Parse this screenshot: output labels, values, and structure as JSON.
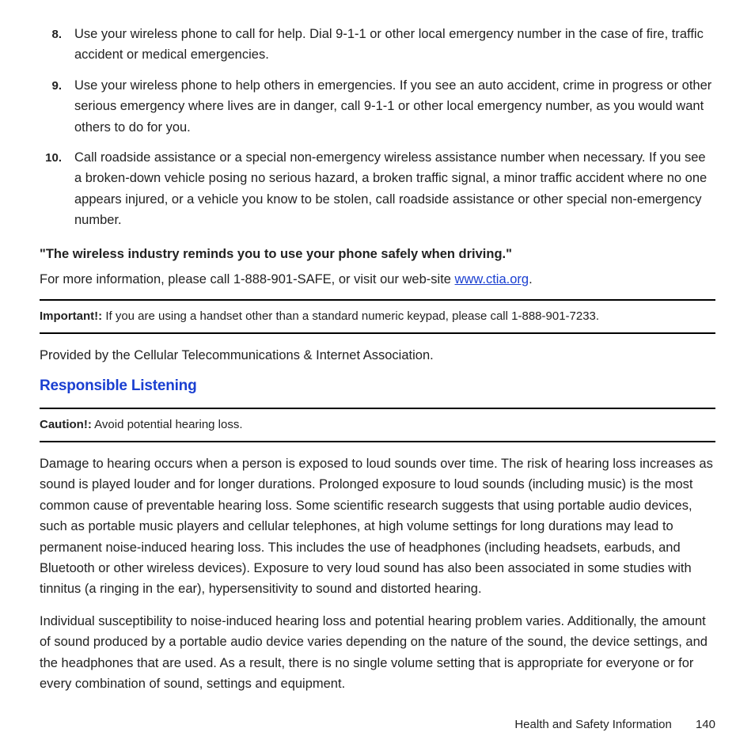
{
  "list": [
    {
      "num": "8.",
      "text": "Use your wireless phone to call for help. Dial 9-1-1 or other local emergency number in the case of fire, traffic accident or medical emergencies."
    },
    {
      "num": "9.",
      "text": "Use your wireless phone to help others in emergencies. If you see an auto accident, crime in progress or other serious emergency where lives are in danger, call 9-1-1 or other local emergency number, as you would want others to do for you."
    },
    {
      "num": "10.",
      "text": "Call roadside assistance or a special non-emergency wireless assistance number when necessary. If you see a broken-down vehicle posing no serious hazard, a broken traffic signal, a minor traffic accident where no one appears injured, or a vehicle you know to be stolen, call roadside assistance or other special non-emergency number."
    }
  ],
  "reminder": "\"The wireless industry reminds you to use your phone safely when driving.\"",
  "moreInfoPrefix": "For more information, please call 1-888-901-SAFE, or visit our web-site ",
  "link": "www.ctia.org",
  "moreInfoSuffix": ".",
  "important": {
    "label": "Important!:",
    "text": " If you are using a handset other than a standard numeric keypad, please call 1-888-901-7233."
  },
  "provided": "Provided by the Cellular Telecommunications & Internet Association.",
  "heading": "Responsible Listening",
  "caution": {
    "label": "Caution!:",
    "text": " Avoid potential hearing loss."
  },
  "para1": "Damage to hearing occurs when a person is exposed to loud sounds over time. The risk of hearing loss increases as sound is played louder and for longer durations. Prolonged exposure to loud sounds (including music) is the most common cause of preventable hearing loss. Some scientific research suggests that using portable audio devices, such as portable music players and cellular telephones, at high volume settings for long durations may lead to permanent noise-induced hearing loss. This includes the use of headphones (including headsets, earbuds, and Bluetooth or other wireless devices). Exposure to very loud sound has also been associated in some studies with tinnitus (a ringing in the ear), hypersensitivity to sound and distorted hearing.",
  "para2": "Individual susceptibility to noise-induced hearing loss and potential hearing problem varies. Additionally, the amount of sound produced by a portable audio device varies depending on the nature of the sound, the device settings, and the headphones that are used. As a result, there is no single volume setting that is appropriate for everyone or for every combination of sound, settings and equipment.",
  "footer": {
    "section": "Health and Safety Information",
    "page": "140"
  }
}
